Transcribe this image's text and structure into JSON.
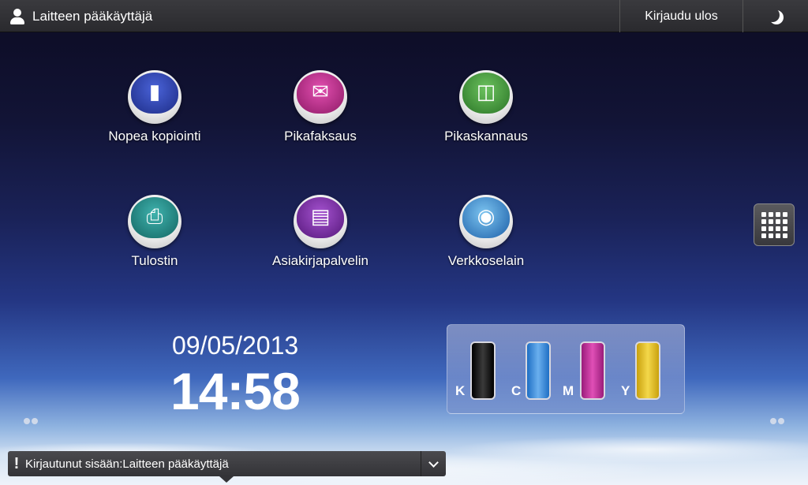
{
  "header": {
    "user_icon": "user-icon",
    "user_name": "Laitteen pääkäyttäjä",
    "logout_label": "Kirjaudu ulos",
    "sleep_icon": "moon-icon"
  },
  "apps": [
    {
      "label": "Nopea kopiointi",
      "icon": "copy-icon",
      "color": "#2b3fa8"
    },
    {
      "label": "Pikafaksaus",
      "icon": "fax-icon",
      "color": "#c2308a"
    },
    {
      "label": "Pikaskannaus",
      "icon": "scanner-icon",
      "color": "#3f9a3a"
    },
    {
      "label": "Tulostin",
      "icon": "printer-icon",
      "color": "#1f8a86"
    },
    {
      "label": "Asiakirjapalvelin",
      "icon": "document-server-icon",
      "color": "#7a2ea6"
    },
    {
      "label": "Verkkoselain",
      "icon": "globe-icon",
      "color": "#2f7fc6"
    }
  ],
  "launcher_icon": "app-grid-icon",
  "clock": {
    "date": "09/05/2013",
    "time": "14:58"
  },
  "toners": [
    {
      "letter": "K",
      "color": "#1c1c1c"
    },
    {
      "letter": "C",
      "color": "#3b8fe0"
    },
    {
      "letter": "M",
      "color": "#c2309a"
    },
    {
      "letter": "Y",
      "color": "#e6c21e"
    }
  ],
  "status": {
    "message": "Kirjautunut sisään:Laitteen pääkäyttäjä",
    "icon": "exclamation-icon",
    "expand_icon": "chevron-down-icon"
  }
}
